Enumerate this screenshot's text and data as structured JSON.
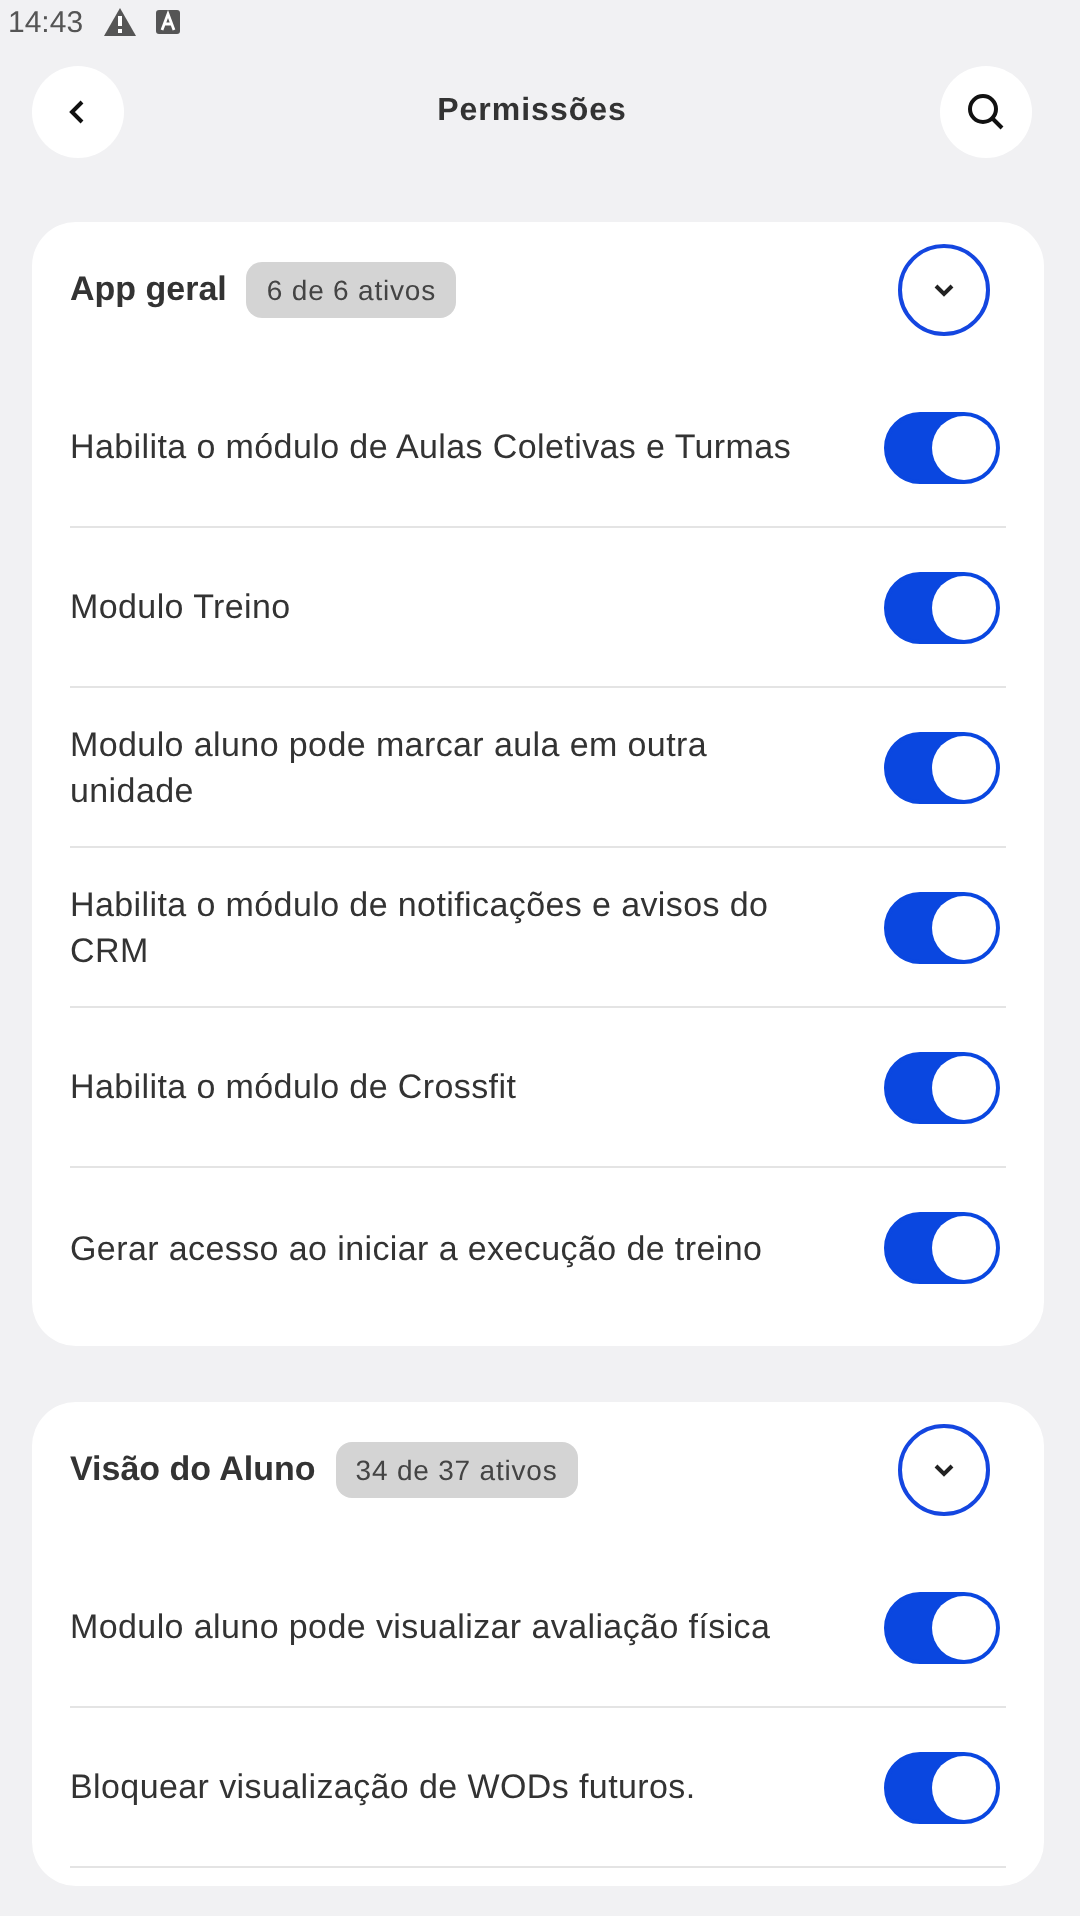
{
  "status_bar": {
    "time": "14:43"
  },
  "header": {
    "title": "Permissões"
  },
  "sections": [
    {
      "title": "App geral",
      "badge": "6 de 6 ativos",
      "expanded": true,
      "items": [
        {
          "label": "Habilita o módulo de Aulas Coletivas e Turmas",
          "on": true
        },
        {
          "label": "Modulo Treino",
          "on": true
        },
        {
          "label": "Modulo aluno pode marcar aula em outra unidade",
          "on": true
        },
        {
          "label": "Habilita o módulo de notificações e avisos do CRM",
          "on": true
        },
        {
          "label": "Habilita o módulo de Crossfit",
          "on": true
        },
        {
          "label": "Gerar acesso ao iniciar a execução de treino",
          "on": true
        }
      ]
    },
    {
      "title": "Visão do Aluno",
      "badge": "34 de 37 ativos",
      "expanded": true,
      "items": [
        {
          "label": "Modulo aluno pode visualizar avaliação física",
          "on": true
        },
        {
          "label": "Bloquear visualização de WODs futuros.",
          "on": true
        }
      ]
    }
  ]
}
